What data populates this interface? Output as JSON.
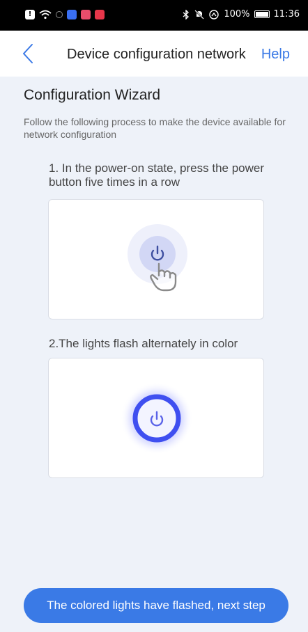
{
  "status_bar": {
    "battery": "100%",
    "time": "11:36",
    "icons": [
      "alert-icon",
      "wifi-icon",
      "circle-icon",
      "app-icon-blue",
      "app-icon-pink",
      "app-icon-red",
      "bluetooth-icon",
      "mute-icon",
      "data-icon",
      "battery-icon"
    ]
  },
  "nav": {
    "title": "Device configuration network",
    "help": "Help"
  },
  "wizard": {
    "title": "Configuration Wizard",
    "description_line1": "Follow the following process to make the device available for",
    "description_line2": "network configuration"
  },
  "steps": [
    {
      "text": "1. In the power-on state, press the power button five times in a row"
    },
    {
      "text": "2.The lights flash alternately in color"
    }
  ],
  "next_button": "The colored lights have flashed, next step",
  "colors": {
    "accent": "#3a7ae6",
    "ring": "#3f4ff0",
    "background": "#eef2f9"
  }
}
